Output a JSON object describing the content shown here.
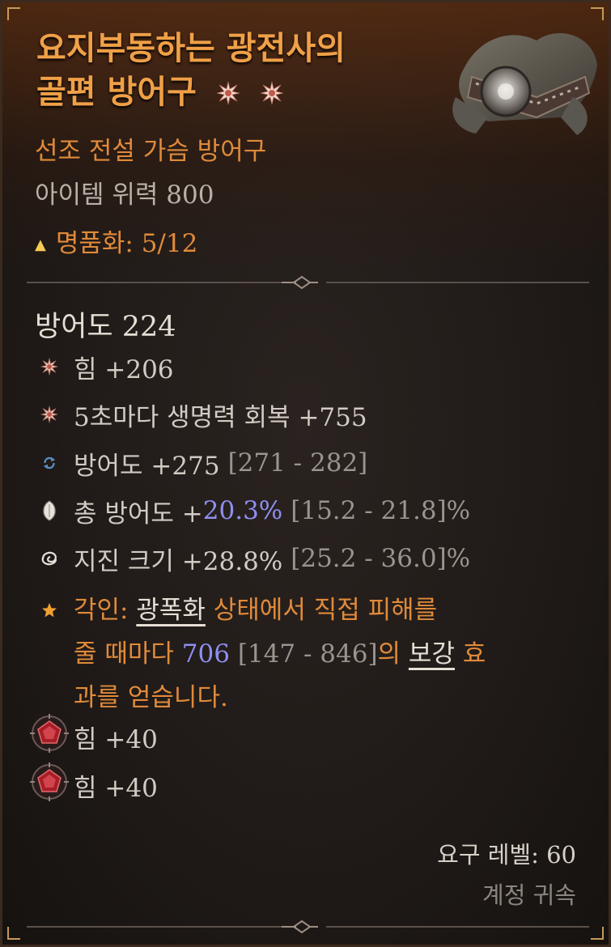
{
  "item": {
    "name_line1": "요지부동하는 광전사의",
    "name_line2": "골편 방어구",
    "type": "선조 전설 가슴 방어구",
    "power": "아이템 위력 800",
    "masterwork": "명품화: 5/12",
    "armor": "방어도 224",
    "rarity_color": "#f0a047"
  },
  "affixes": [
    {
      "icon": "sun-star-icon",
      "text": "힘 +206"
    },
    {
      "icon": "sun-star-icon",
      "text": "5초마다 생명력 회복 +755"
    },
    {
      "icon": "reroll-icon",
      "text": "방어도 +275",
      "range": "[271 - 282]"
    },
    {
      "icon": "shield-icon",
      "text_prefix": "총 방어도 +",
      "highlight": "20.3%",
      "range": "[15.2 - 21.8]%"
    },
    {
      "icon": "swirl-icon",
      "text": "지진 크기 +28.8%",
      "range": "[25.2 - 36.0]%"
    }
  ],
  "aspect": {
    "icon": "star-icon",
    "label": "각인: ",
    "keyword1": "광폭화",
    "t1": " 상태에서 직접 피해를",
    "t2": "줄 때마다 ",
    "value": "706",
    "range": " [147 - 846]",
    "t3": "의 ",
    "keyword2": "보강",
    "t4": " 효",
    "t5": "과를 얻습니다."
  },
  "sockets": [
    {
      "icon": "ruby-gem-icon",
      "text": "힘 +40"
    },
    {
      "icon": "ruby-gem-icon",
      "text": "힘 +40"
    }
  ],
  "footer": {
    "required_level": "요구 레벨: 60",
    "account_bound": "계정 귀속"
  },
  "colors": {
    "legendary": "#e08a3a",
    "highlight_blue": "#8f8ff2",
    "range_gray": "#9a948e"
  }
}
